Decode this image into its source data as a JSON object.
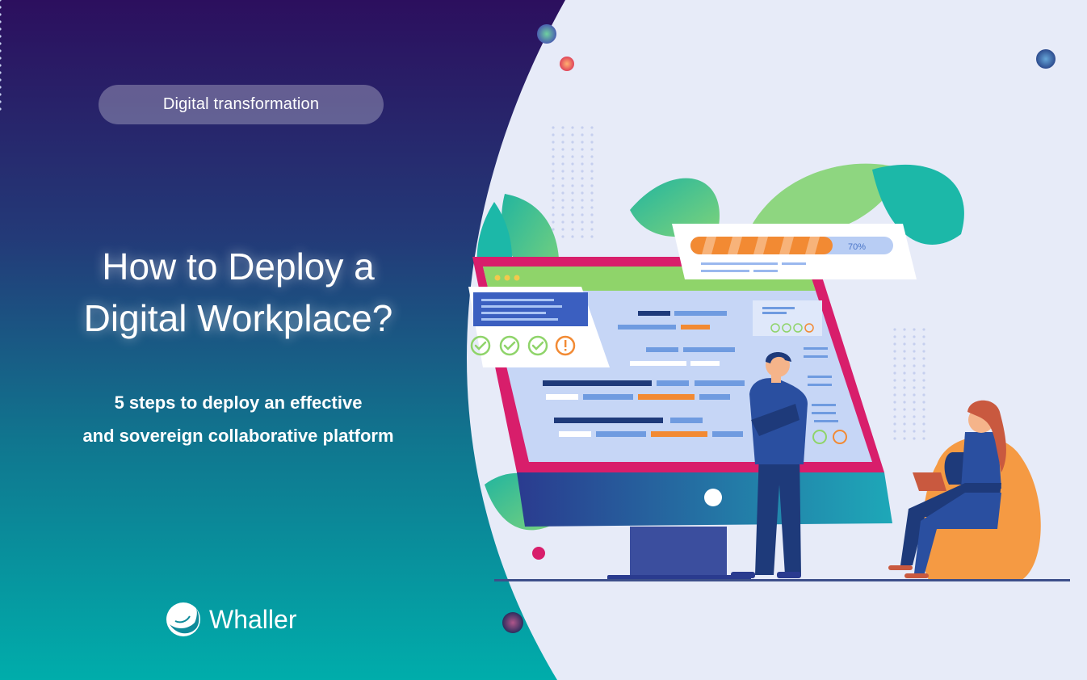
{
  "category_label": "Digital transformation",
  "headline": {
    "line1": "How to Deploy a",
    "line2": "Digital Workplace?"
  },
  "subheadline": {
    "line1": "5 steps to deploy an effective",
    "line2": "and sovereign collaborative platform"
  },
  "brand": {
    "name": "Whaller"
  },
  "illustration": {
    "progress_label": "70%",
    "progress_fraction": 0.7
  },
  "colors": {
    "gradient_top": "#2b1060",
    "gradient_bottom": "#00a8a8",
    "light_bg": "#e7ebf8",
    "teal_leaf": "#1cb8a8",
    "monitor_frame": "#d81e6b",
    "progress_orange": "#f28a33",
    "navy": "#1e3a7a"
  },
  "icons": [
    "whaller-logo-icon",
    "check-icon",
    "warning-icon"
  ]
}
